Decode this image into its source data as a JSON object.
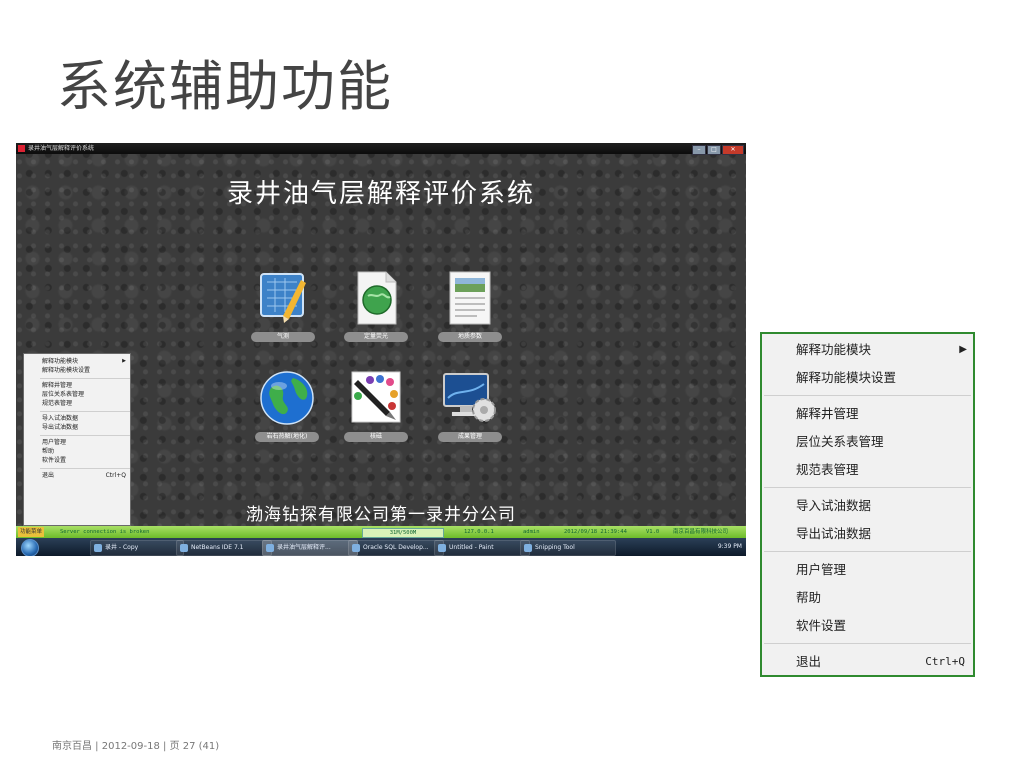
{
  "slide": {
    "title": "系统辅助功能",
    "footer": "南京百昌 | 2012-09-18 | 页 27 (41)"
  },
  "app": {
    "window_title": "录井油气层解释评价系统",
    "heading": "录井油气层解释评价系统",
    "company": "渤海钻探有限公司第一录井分公司",
    "tiles": [
      {
        "label": "气测",
        "icon": "blueprint-pencil-icon"
      },
      {
        "label": "定量荧光",
        "icon": "globe-document-icon"
      },
      {
        "label": "地质参数",
        "icon": "report-document-icon"
      },
      {
        "label": "岩石热解(地化)",
        "icon": "earth-globe-icon"
      },
      {
        "label": "核磁",
        "icon": "paint-pen-icon"
      },
      {
        "label": "成果管理",
        "icon": "monitor-gear-icon"
      }
    ],
    "menu": {
      "items": [
        {
          "label": "解释功能模块",
          "has_submenu": true
        },
        {
          "label": "解释功能模块设置"
        },
        {
          "label": "解释井管理"
        },
        {
          "label": "层位关系表管理"
        },
        {
          "label": "规范表管理"
        },
        {
          "label": "导入试油数据"
        },
        {
          "label": "导出试油数据"
        },
        {
          "label": "用户管理"
        },
        {
          "label": "帮助"
        },
        {
          "label": "软件设置"
        },
        {
          "label": "退出",
          "shortcut": "Ctrl+Q"
        }
      ]
    },
    "statusbar": {
      "start": "功能菜单",
      "connection": "Server connection is broken",
      "memory": "31M/500M",
      "ip": "127.0.0.1",
      "user": "admin",
      "datetime": "2012/09/18 21:39:44",
      "version": "V1.0",
      "vendor": "南京百昌有限科技公司"
    },
    "taskbar": {
      "buttons": [
        "录井 - Copy",
        "NetBeans IDE 7.1",
        "录井油气层解释评...",
        "Oracle SQL Develop...",
        "Untitled - Paint",
        "Snipping Tool"
      ],
      "clock": "9:39 PM"
    }
  },
  "context_menu": {
    "items": [
      {
        "label": "解释功能模块",
        "has_submenu": true
      },
      {
        "label": "解释功能模块设置"
      },
      {
        "label": "解释井管理"
      },
      {
        "label": "层位关系表管理"
      },
      {
        "label": "规范表管理"
      },
      {
        "label": "导入试油数据"
      },
      {
        "label": "导出试油数据"
      },
      {
        "label": "用户管理"
      },
      {
        "label": "帮助"
      },
      {
        "label": "软件设置"
      },
      {
        "label": "退出",
        "shortcut": "Ctrl+Q"
      }
    ],
    "border_color": "#2f8a2f"
  }
}
